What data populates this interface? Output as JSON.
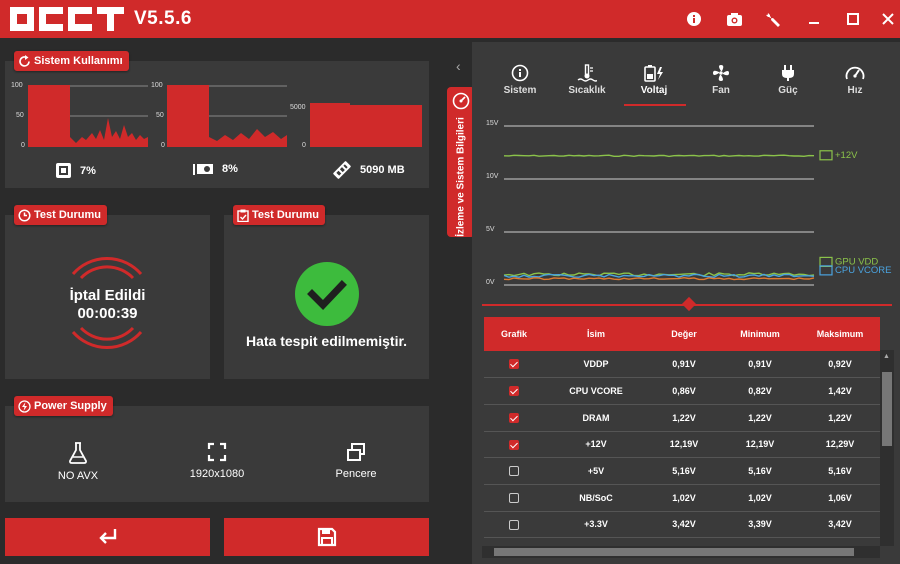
{
  "app": {
    "version": "V5.5.6"
  },
  "titlebar_icons": [
    "info-icon",
    "camera-icon",
    "wrench-icon",
    "minimize-icon",
    "maximize-icon",
    "close-icon"
  ],
  "usage": {
    "title": "Sistem Kullanımı",
    "cpu": {
      "axis": [
        "100",
        "50",
        "0"
      ],
      "value": "7%"
    },
    "gpu": {
      "axis": [
        "100",
        "50",
        "0"
      ],
      "value": "8%"
    },
    "ram": {
      "axis": [
        "5000",
        "0"
      ],
      "value": "5090 MB"
    }
  },
  "test_status_left": {
    "title": "Test Durumu",
    "line1": "İptal Edildi",
    "line2": "00:00:39"
  },
  "test_status_right": {
    "title": "Test Durumu",
    "message": "Hata tespit edilmemiştir."
  },
  "power_supply": {
    "title": "Power Supply",
    "items": [
      {
        "icon": "flask-icon",
        "label": "NO AVX"
      },
      {
        "icon": "fullscreen-icon",
        "label": "1920x1080"
      },
      {
        "icon": "window-icon",
        "label": "Pencere"
      }
    ]
  },
  "actions": {
    "left_icon": "enter-icon",
    "right_icon": "save-icon"
  },
  "side_tab": {
    "label": "İzleme ve Sistem Bilgileri"
  },
  "tabs": [
    {
      "label": "Sistem",
      "icon": "info-icon"
    },
    {
      "label": "Sıcaklık",
      "icon": "temperature-icon"
    },
    {
      "label": "Voltaj",
      "icon": "battery-icon",
      "active": true
    },
    {
      "label": "Fan",
      "icon": "fan-icon"
    },
    {
      "label": "Güç",
      "icon": "plug-icon"
    },
    {
      "label": "Hız",
      "icon": "gauge-icon"
    }
  ],
  "chart_data": {
    "type": "line",
    "ylim": [
      0,
      15
    ],
    "yticks": [
      "15V",
      "10V",
      "5V",
      "0V"
    ],
    "series": [
      {
        "name": "+12V",
        "color": "#8bc34a",
        "level": 12.19
      },
      {
        "name": "GPU VDD",
        "color": "#8bc34a",
        "level": 1.0
      },
      {
        "name": "CPU VCORE",
        "color": "#4aa3df",
        "level": 0.86
      }
    ]
  },
  "table": {
    "headers": [
      "Grafik",
      "İsim",
      "Değer",
      "Minimum",
      "Maksimum"
    ],
    "rows": [
      {
        "checked": true,
        "name": "VDDP",
        "value": "0,91V",
        "min": "0,91V",
        "max": "0,92V"
      },
      {
        "checked": true,
        "name": "CPU VCORE",
        "value": "0,86V",
        "min": "0,82V",
        "max": "1,42V"
      },
      {
        "checked": true,
        "name": "DRAM",
        "value": "1,22V",
        "min": "1,22V",
        "max": "1,22V"
      },
      {
        "checked": true,
        "name": "+12V",
        "value": "12,19V",
        "min": "12,19V",
        "max": "12,29V"
      },
      {
        "checked": false,
        "name": "+5V",
        "value": "5,16V",
        "min": "5,16V",
        "max": "5,16V"
      },
      {
        "checked": false,
        "name": "NB/SoC",
        "value": "1,02V",
        "min": "1,02V",
        "max": "1,06V"
      },
      {
        "checked": false,
        "name": "+3.3V",
        "value": "3,42V",
        "min": "3,39V",
        "max": "3,42V"
      }
    ]
  }
}
